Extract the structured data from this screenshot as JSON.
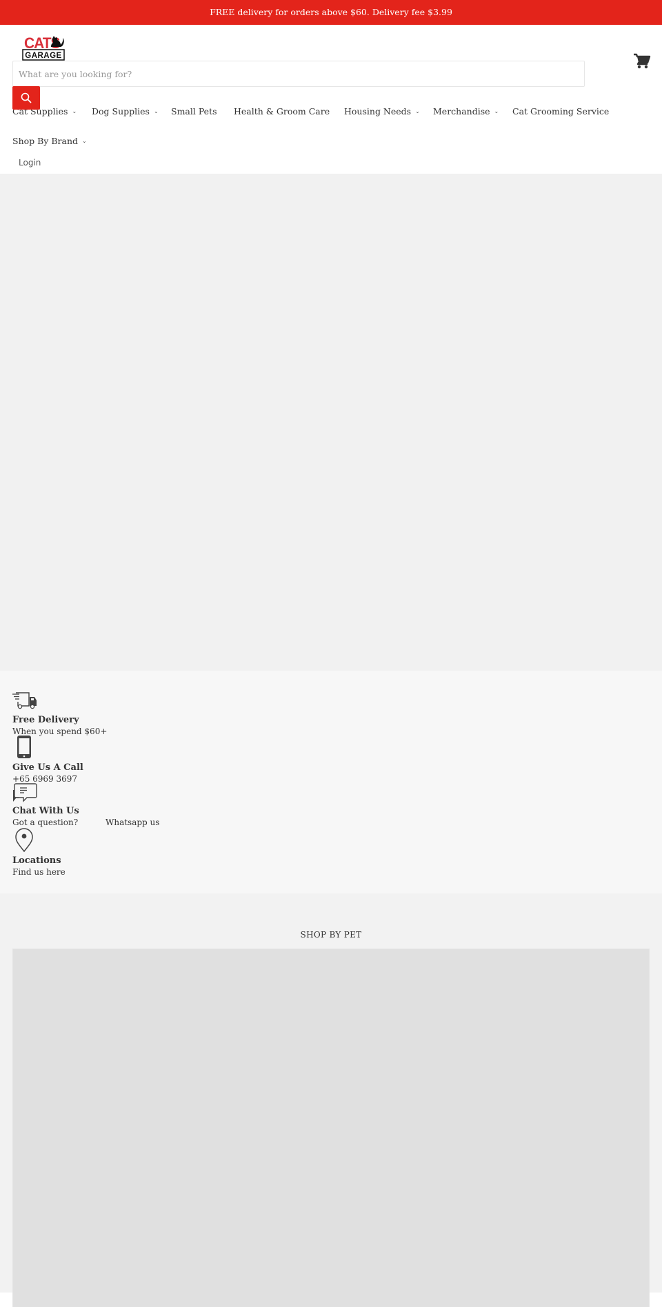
{
  "announcement": {
    "text": "FREE delivery for orders above $60. Delivery fee $3.99",
    "background_color": "#e3241b"
  },
  "header": {
    "logo": {
      "line1": "CATS",
      "line2": "GARAGE",
      "icon": "cat-logo-icon"
    },
    "search": {
      "placeholder": "What are you looking for?",
      "value": "",
      "button_icon": "search-icon"
    },
    "cart_icon": "cart-icon",
    "nav_row1": [
      {
        "label": "Cat Supplies",
        "has_dropdown": true
      },
      {
        "label": "Dog Supplies",
        "has_dropdown": true
      },
      {
        "label": "Small Pets",
        "has_dropdown": false
      },
      {
        "label": "Health & Groom Care",
        "has_dropdown": false
      },
      {
        "label": "Housing Needs",
        "has_dropdown": true
      },
      {
        "label": "Merchandise",
        "has_dropdown": true
      },
      {
        "label": "Cat Grooming Service",
        "has_dropdown": false
      }
    ],
    "nav_row2": [
      {
        "label": "Shop By Brand",
        "has_dropdown": true
      }
    ],
    "chevron_glyph": "⌄",
    "login_label": "Login"
  },
  "features": [
    {
      "icon": "delivery-truck-icon",
      "title": "Free Delivery",
      "text": "When you spend $60+"
    },
    {
      "icon": "phone-icon",
      "title": "Give Us A Call",
      "text": "+65 6969 3697"
    },
    {
      "icon": "chat-icon",
      "title": "Chat With Us",
      "text": "Got a question?",
      "link": "Whatsapp us"
    },
    {
      "icon": "location-pin-icon",
      "title": "Locations",
      "text": "Find us here"
    }
  ],
  "shop_by_pet": {
    "title": "SHOP BY PET"
  },
  "colors": {
    "accent": "#e3241b",
    "text": "#333333",
    "hero_bg": "#f1f1f1",
    "features_bg": "#f7f7f7",
    "placeholder_bg": "#e0e0e0"
  }
}
